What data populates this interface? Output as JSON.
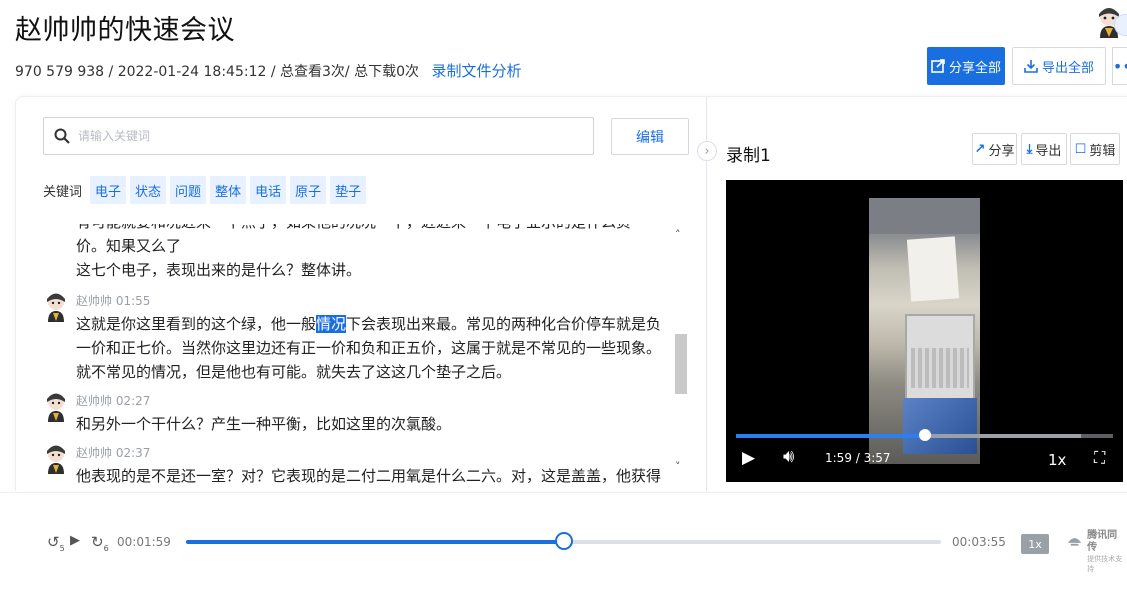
{
  "header": {
    "title": "赵帅帅的快速会议",
    "meeting_id": "970 579 938",
    "datetime": "/ 2022-01-24 18:45:12",
    "stats": "/ 总查看3次/ 总下载0次",
    "analysis_link": "录制文件分析",
    "share_all": "分享全部",
    "export_all": "导出全部",
    "more": "•••"
  },
  "search": {
    "placeholder": "请输入关键词",
    "edit_label": "编辑"
  },
  "keywords": {
    "label": "关键词",
    "items": [
      "电子",
      "状态",
      "问题",
      "整体",
      "电话",
      "原子",
      "垫子"
    ]
  },
  "transcript": {
    "cut_line": "有可能就要和况近来一下点了，如果他的况况一下，近近来一下电子业示的是什么负一价。知果又么了",
    "first_tail": "这七个电子，表现出来的是什么？整体讲。",
    "segments": [
      {
        "speaker": "赵帅帅 01:55",
        "before": "这就是你这里看到的这个绿，他一般",
        "highlight": "情况",
        "after": "下会表现出来最。常见的两种化合价停车就是负一价和正七价。当然你这里边还有正一价和负和正五价，这属于就是不常见的一些现象。就不常见的情况，但是他也有可能。就失去了这这几个垫子之后。"
      },
      {
        "speaker": "赵帅帅 02:27",
        "text": "和另外一个干什么？产生一种平衡，比如这里的次氯酸。"
      },
      {
        "speaker": "赵帅帅 02:37",
        "text": "他表现的是不是还一室？对？它表现的是二付二用氧是什么二六。对，这是盖盖，他获得两个原子，这是"
      }
    ]
  },
  "recording": {
    "title": "录制1",
    "share": "分享",
    "export": "导出",
    "clip": "剪辑",
    "time_display": "1:59 / 3:57",
    "speed": "1x",
    "progress": 0.5
  },
  "player": {
    "current": "00:01:59",
    "duration": "00:03:55",
    "speed": "1x",
    "progress": 0.5,
    "back_label": "5",
    "fwd_label": "6",
    "brand_name": "腾讯同传",
    "brand_sub": "提供技术支持"
  },
  "colors": {
    "accent": "#1a6fe0",
    "tag_bg": "#e8f1ff"
  }
}
